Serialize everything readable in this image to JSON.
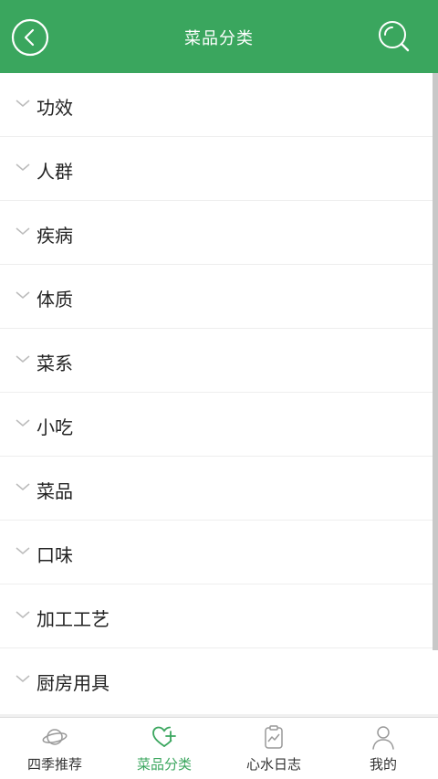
{
  "header": {
    "title": "菜品分类",
    "back_icon": "back-circle-icon",
    "search_icon": "search-icon",
    "color": "#3aa65e"
  },
  "categories": [
    {
      "label": "功效"
    },
    {
      "label": "人群"
    },
    {
      "label": "疾病"
    },
    {
      "label": "体质"
    },
    {
      "label": "菜系"
    },
    {
      "label": "小吃"
    },
    {
      "label": "菜品"
    },
    {
      "label": "口味"
    },
    {
      "label": "加工工艺"
    },
    {
      "label": "厨房用具"
    }
  ],
  "tabbar": {
    "active_color": "#3aa65e",
    "items": [
      {
        "label": "四季推荐",
        "icon": "planet-icon",
        "active": false
      },
      {
        "label": "菜品分类",
        "icon": "heart-plus-icon",
        "active": true
      },
      {
        "label": "心水日志",
        "icon": "clipboard-chart-icon",
        "active": false
      },
      {
        "label": "我的",
        "icon": "user-icon",
        "active": false
      }
    ]
  }
}
